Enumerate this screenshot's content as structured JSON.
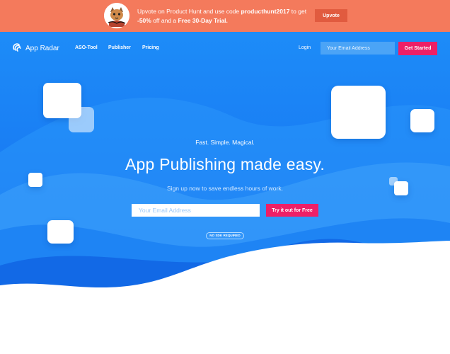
{
  "promo": {
    "text_before": "Upvote on Product Hunt and use code ",
    "code": "producthunt2017",
    "text_middle": " to get ",
    "discount": "-50%",
    "text_after": " off and a ",
    "trial": "Free 30-Day Trial.",
    "upvote_label": "Upvote"
  },
  "nav": {
    "brand": "App Radar",
    "links": [
      "ASO-Tool",
      "Publisher",
      "Pricing"
    ],
    "login": "Login",
    "email_placeholder": "Your Email Address",
    "cta": "Get Started"
  },
  "hero": {
    "tagline": "Fast. Simple. Magical.",
    "headline": "App Publishing made easy.",
    "subheadline": "Sign up now to save endless hours of work.",
    "email_placeholder": "Your Email Address",
    "cta": "Try it out for Free",
    "badge": "NO SDK REQUIRED"
  },
  "colors": {
    "promo_bg": "#f47a5c",
    "upvote_bg": "#e15b3f",
    "hero_blue": "#1877f2",
    "cta_pink": "#ee1f66"
  }
}
